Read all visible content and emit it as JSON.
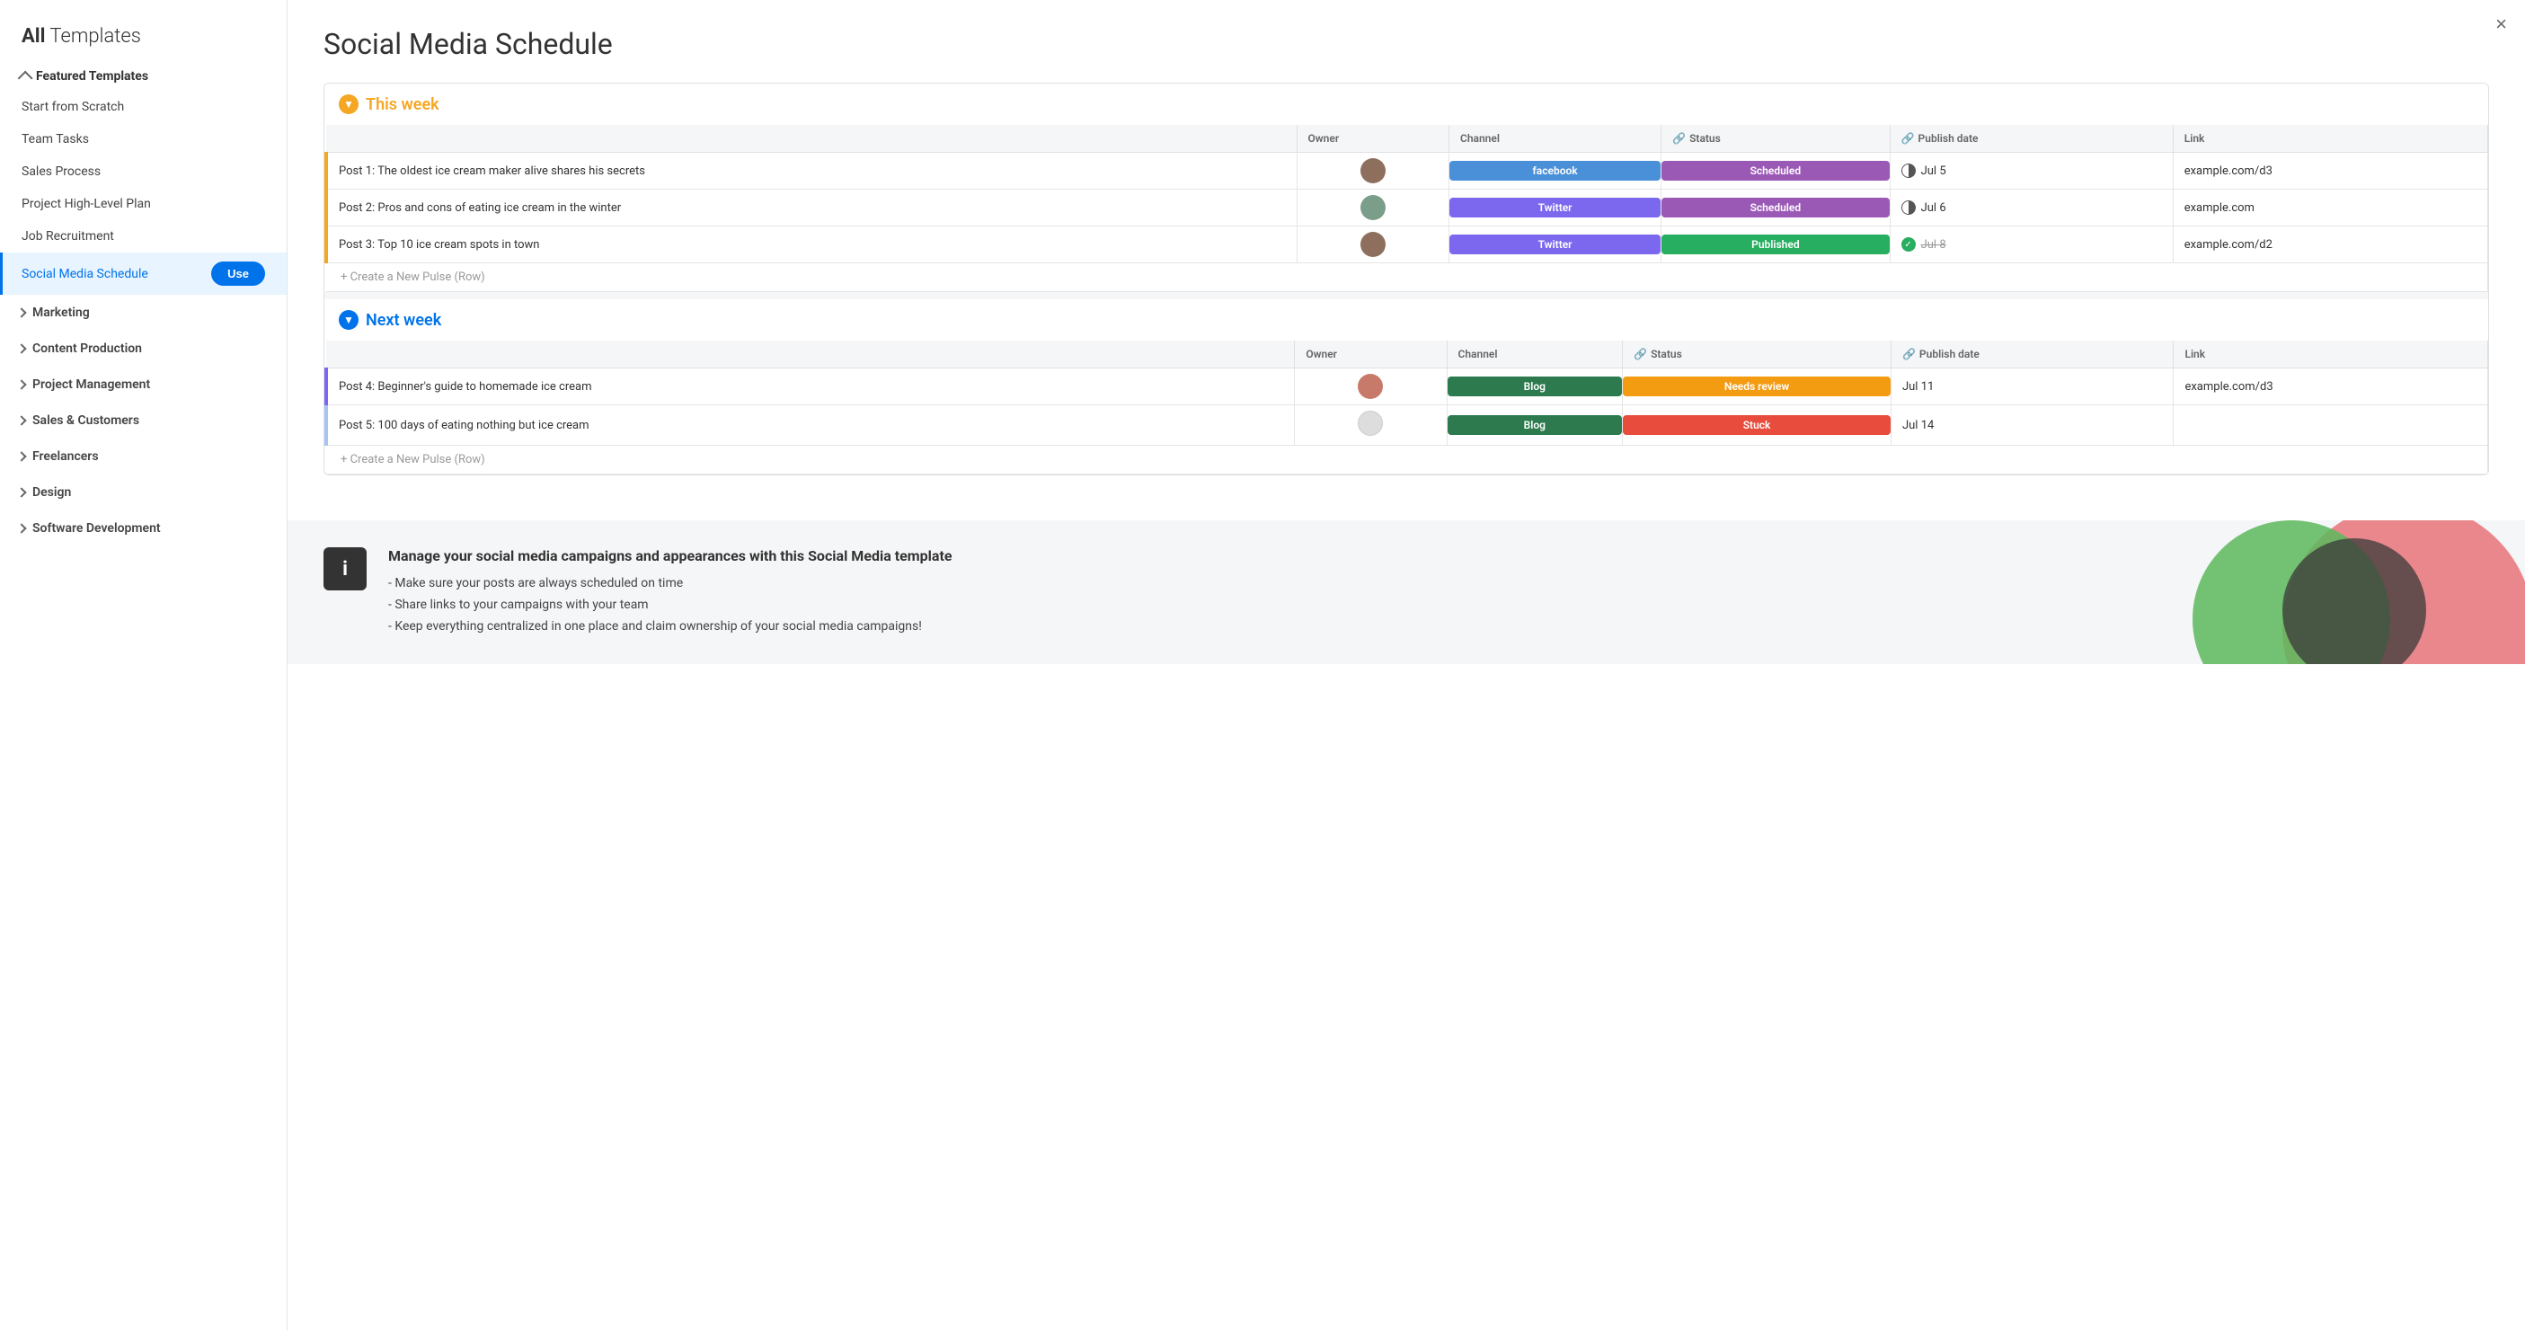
{
  "sidebar": {
    "title_bold": "All",
    "title_normal": " Templates",
    "featured": {
      "label": "Featured Templates",
      "items": [
        {
          "id": "start-scratch",
          "label": "Start from Scratch",
          "active": false
        },
        {
          "id": "team-tasks",
          "label": "Team Tasks",
          "active": false
        },
        {
          "id": "sales-process",
          "label": "Sales Process",
          "active": false
        },
        {
          "id": "project-high-level",
          "label": "Project High-Level Plan",
          "active": false
        },
        {
          "id": "job-recruitment",
          "label": "Job Recruitment",
          "active": false
        },
        {
          "id": "social-media",
          "label": "Social Media Schedule",
          "active": true
        }
      ]
    },
    "collapsed_sections": [
      {
        "id": "marketing",
        "label": "Marketing"
      },
      {
        "id": "content-production",
        "label": "Content Production"
      },
      {
        "id": "project-management",
        "label": "Project Management"
      },
      {
        "id": "sales-customers",
        "label": "Sales & Customers"
      },
      {
        "id": "freelancers",
        "label": "Freelancers"
      },
      {
        "id": "design",
        "label": "Design"
      },
      {
        "id": "software-development",
        "label": "Software Development"
      }
    ],
    "use_button_label": "Use"
  },
  "main": {
    "page_title": "Social Media Schedule",
    "close_label": "×",
    "groups": [
      {
        "id": "this-week",
        "name": "This week",
        "color": "orange",
        "rows": [
          {
            "name": "Post 1: The oldest ice cream maker alive shares his secrets",
            "owner_color": "#8e6f5e",
            "channel": "facebook",
            "channel_label": "facebook",
            "status": "scheduled",
            "status_label": "Scheduled",
            "date_icon": "half",
            "date": "Jul 5",
            "link": "example.com/d3",
            "border_color": "yellow"
          },
          {
            "name": "Post 2: Pros and cons of eating ice cream in the winter",
            "owner_color": "#7a9e8a",
            "channel": "twitter",
            "channel_label": "Twitter",
            "status": "scheduled",
            "status_label": "Scheduled",
            "date_icon": "half",
            "date": "Jul 6",
            "link": "example.com",
            "border_color": "yellow"
          },
          {
            "name": "Post 3: Top 10 ice cream spots in town",
            "owner_color": "#8e6f5e",
            "channel": "twitter",
            "channel_label": "Twitter",
            "status": "published",
            "status_label": "Published",
            "date_icon": "check",
            "date": "Jul 8",
            "date_struck": true,
            "link": "example.com/d2",
            "border_color": "yellow"
          }
        ],
        "create_label": "+ Create a New Pulse (Row)"
      },
      {
        "id": "next-week",
        "name": "Next week",
        "color": "blue",
        "rows": [
          {
            "name": "Post 4: Beginner's guide to homemade ice cream",
            "owner_color": "#c87a6a",
            "channel": "blog",
            "channel_label": "Blog",
            "status": "needs-review",
            "status_label": "Needs review",
            "date_icon": "none",
            "date": "Jul 11",
            "link": "example.com/d3",
            "border_color": "blue"
          },
          {
            "name": "Post 5: 100 days of eating nothing but ice cream",
            "owner_color": null,
            "channel": "blog",
            "channel_label": "Blog",
            "status": "stuck",
            "status_label": "Stuck",
            "date_icon": "none",
            "date": "Jul 14",
            "link": "",
            "border_color": "light-blue"
          }
        ],
        "create_label": "+ Create a New Pulse (Row)"
      }
    ],
    "table_headers": {
      "owner": "Owner",
      "channel": "Channel",
      "status": "Status",
      "publish_date": "Publish date",
      "link": "Link"
    },
    "description": {
      "title": "Manage your social media campaigns and appearances with this Social Media template",
      "bullets": [
        "Make sure your posts are always scheduled on time",
        "Share links to your campaigns with your team",
        "Keep everything centralized in one place and claim ownership of your social media campaigns!"
      ]
    }
  }
}
